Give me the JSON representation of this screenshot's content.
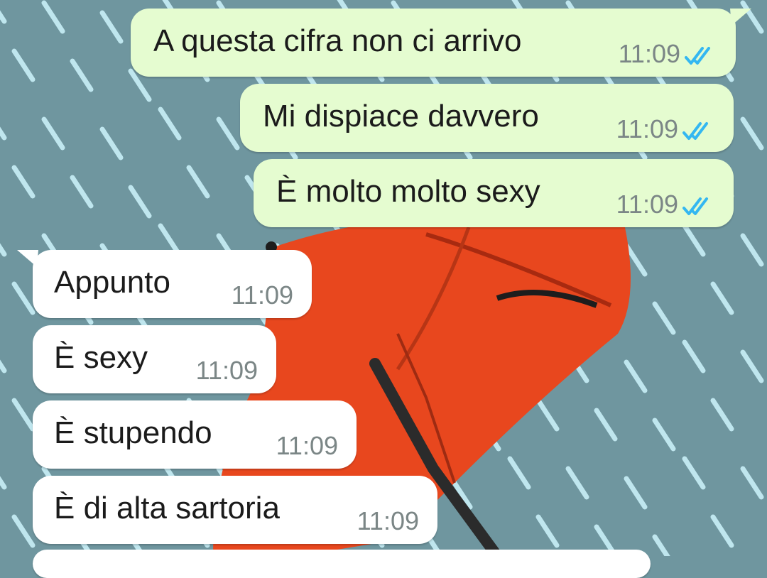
{
  "conversation": {
    "sent": [
      {
        "text": "A questa cifra non ci arrivo",
        "time": "11:09",
        "status_icon": "double-check-read-icon"
      },
      {
        "text": "Mi dispiace davvero",
        "time": "11:09",
        "status_icon": "double-check-read-icon"
      },
      {
        "text": "È molto molto sexy",
        "time": "11:09",
        "status_icon": "double-check-read-icon"
      }
    ],
    "received": [
      {
        "text": "Appunto",
        "time": "11:09"
      },
      {
        "text": "È sexy",
        "time": "11:09"
      },
      {
        "text": "È stupendo",
        "time": "11:09"
      },
      {
        "text": "È di alta sartoria",
        "time": "11:09"
      }
    ]
  },
  "colors": {
    "wallpaper": "#6f969f",
    "rain": "#bfe6ee",
    "umbrella": "#e8471e",
    "outgoing_bubble": "#e5fcd0",
    "incoming_bubble": "#ffffff",
    "read_ticks": "#34b7f1",
    "timestamp": "#7b8686"
  }
}
